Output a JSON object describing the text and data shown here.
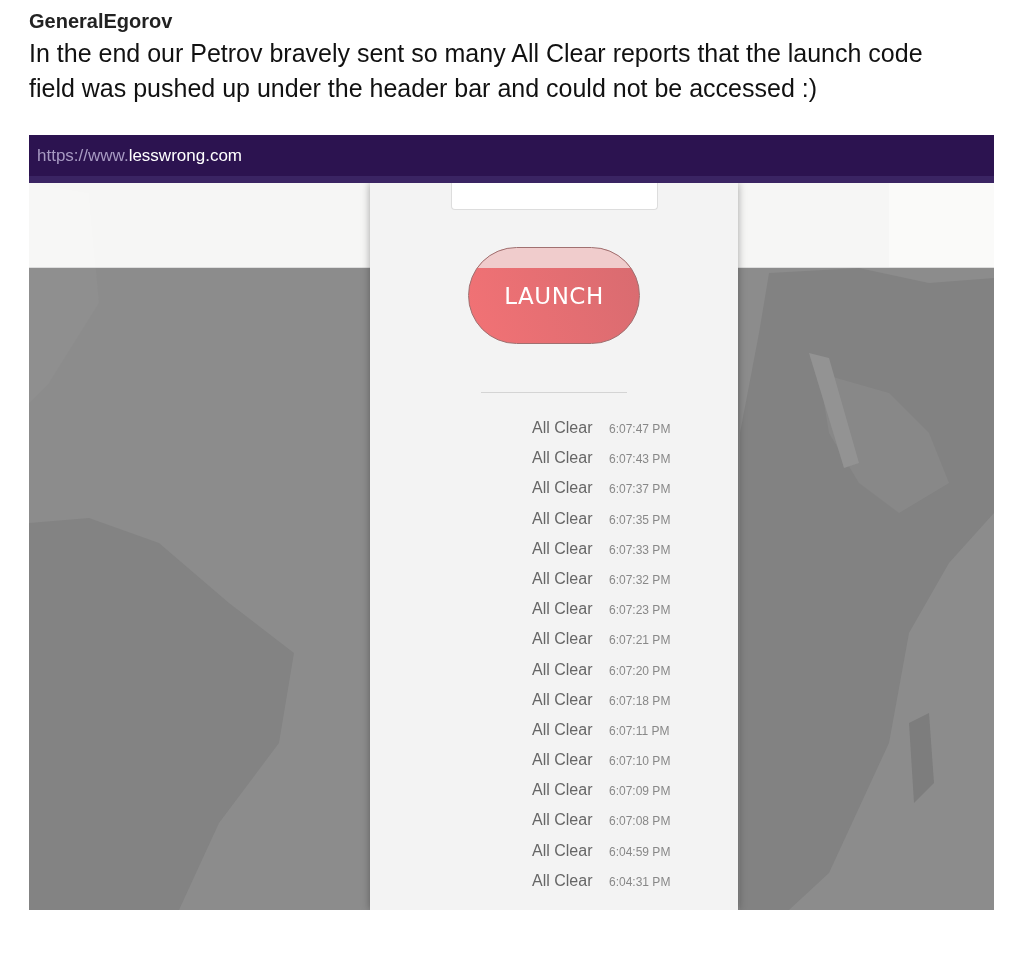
{
  "post": {
    "author": "GeneralEgorov",
    "text": "In the end our Petrov bravely sent so many All Clear reports that the launch code field was pushed up under the header bar and could not be accessed :)"
  },
  "browser": {
    "url_prefix": "https://www.",
    "url_domain": "lesswrong.com"
  },
  "panel": {
    "launch_button": "LAUNCH",
    "reports": [
      {
        "status": "All Clear",
        "time": "6:07:47 PM"
      },
      {
        "status": "All Clear",
        "time": "6:07:43 PM"
      },
      {
        "status": "All Clear",
        "time": "6:07:37 PM"
      },
      {
        "status": "All Clear",
        "time": "6:07:35 PM"
      },
      {
        "status": "All Clear",
        "time": "6:07:33 PM"
      },
      {
        "status": "All Clear",
        "time": "6:07:32 PM"
      },
      {
        "status": "All Clear",
        "time": "6:07:23 PM"
      },
      {
        "status": "All Clear",
        "time": "6:07:21 PM"
      },
      {
        "status": "All Clear",
        "time": "6:07:20 PM"
      },
      {
        "status": "All Clear",
        "time": "6:07:18 PM"
      },
      {
        "status": "All Clear",
        "time": "6:07:11 PM"
      },
      {
        "status": "All Clear",
        "time": "6:07:10 PM"
      },
      {
        "status": "All Clear",
        "time": "6:07:09 PM"
      },
      {
        "status": "All Clear",
        "time": "6:07:08 PM"
      },
      {
        "status": "All Clear",
        "time": "6:04:59 PM"
      },
      {
        "status": "All Clear",
        "time": "6:04:31 PM"
      }
    ]
  }
}
